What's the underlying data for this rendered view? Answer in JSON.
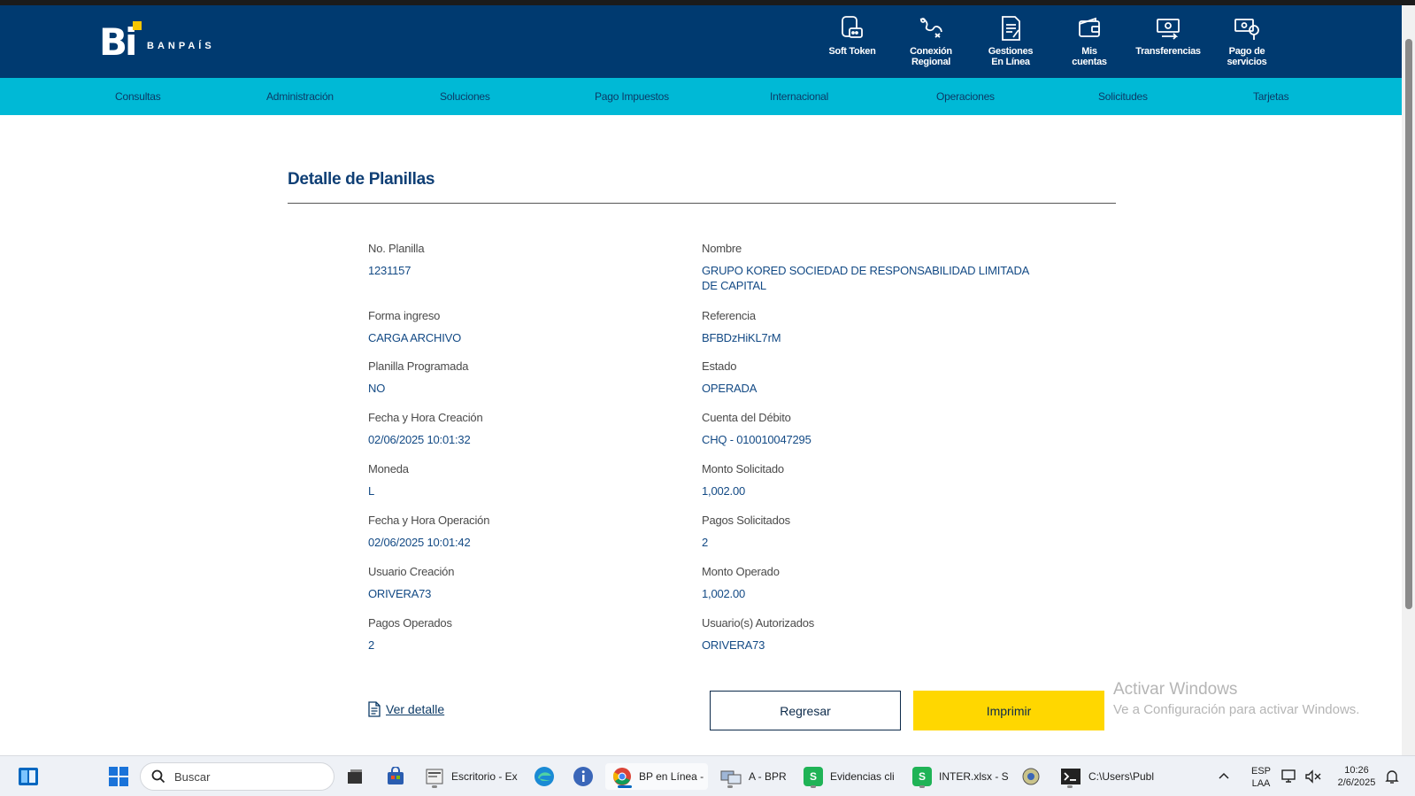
{
  "brand": {
    "name": "BANPAÍS",
    "mark": "Bi",
    "accent": "#f7c600",
    "header_color": "#003a70",
    "menu_color": "#00b9d6"
  },
  "header_nav": [
    {
      "label": "Soft Token",
      "icon": "token-icon"
    },
    {
      "label": "Conexión Regional",
      "icon": "regional-icon"
    },
    {
      "label": "Gestiones En Línea",
      "icon": "document-icon"
    },
    {
      "label": "Mis cuentas",
      "icon": "wallet-icon"
    },
    {
      "label": "Transferencias",
      "icon": "transfer-icon"
    },
    {
      "label": "Pago de servicios",
      "icon": "service-payment-icon"
    }
  ],
  "menu": [
    "Consultas",
    "Administración",
    "Soluciones",
    "Pago Impuestos",
    "Internacional",
    "Operaciones",
    "Solicitudes",
    "Tarjetas"
  ],
  "page": {
    "title": "Detalle de Planillas"
  },
  "fields": [
    {
      "label": "No. Planilla",
      "value": "1231157"
    },
    {
      "label": "Nombre",
      "value": "GRUPO KORED SOCIEDAD DE RESPONSABILIDAD LIMITADA DE CAPITAL"
    },
    {
      "label": "Forma ingreso",
      "value": "CARGA ARCHIVO"
    },
    {
      "label": "Referencia",
      "value": "BFBDzHiKL7rM"
    },
    {
      "label": "Planilla Programada",
      "value": "NO"
    },
    {
      "label": "Estado",
      "value": "OPERADA"
    },
    {
      "label": "Fecha y Hora Creación",
      "value": "02/06/2025 10:01:32"
    },
    {
      "label": "Cuenta del Débito",
      "value": "CHQ - 010010047295"
    },
    {
      "label": "Moneda",
      "value": "L"
    },
    {
      "label": "Monto Solicitado",
      "value": "1,002.00"
    },
    {
      "label": "Fecha y Hora Operación",
      "value": "02/06/2025 10:01:42"
    },
    {
      "label": "Pagos Solicitados",
      "value": "2"
    },
    {
      "label": "Usuario Creación",
      "value": "ORIVERA73"
    },
    {
      "label": "Monto Operado",
      "value": "1,002.00"
    },
    {
      "label": "Pagos Operados",
      "value": "2"
    },
    {
      "label": "Usuario(s) Autorizados",
      "value": "ORIVERA73"
    }
  ],
  "actions": {
    "detail_link": "Ver detalle",
    "back": "Regresar",
    "print": "Imprimir"
  },
  "watermark": {
    "line1": "Activar Windows",
    "line2": "Ve a Configuración para activar Windows."
  },
  "taskbar": {
    "search_placeholder": "Buscar",
    "apps": [
      {
        "label": "Escritorio - Ex",
        "icon": "file-explorer-icon"
      },
      {
        "label": "BP en Línea -",
        "icon": "chrome-icon"
      },
      {
        "label": "A - BPR",
        "icon": "remote-app-icon"
      },
      {
        "label": "Evidencias cli",
        "icon": "spreadsheet-icon"
      },
      {
        "label": "INTER.xlsx - S",
        "icon": "spreadsheet-icon"
      },
      {
        "label": "C:\\Users\\Publ",
        "icon": "terminal-icon"
      }
    ],
    "lang_1": "ESP",
    "lang_2": "LAA",
    "time": "10:26",
    "date": "2/6/2025"
  }
}
